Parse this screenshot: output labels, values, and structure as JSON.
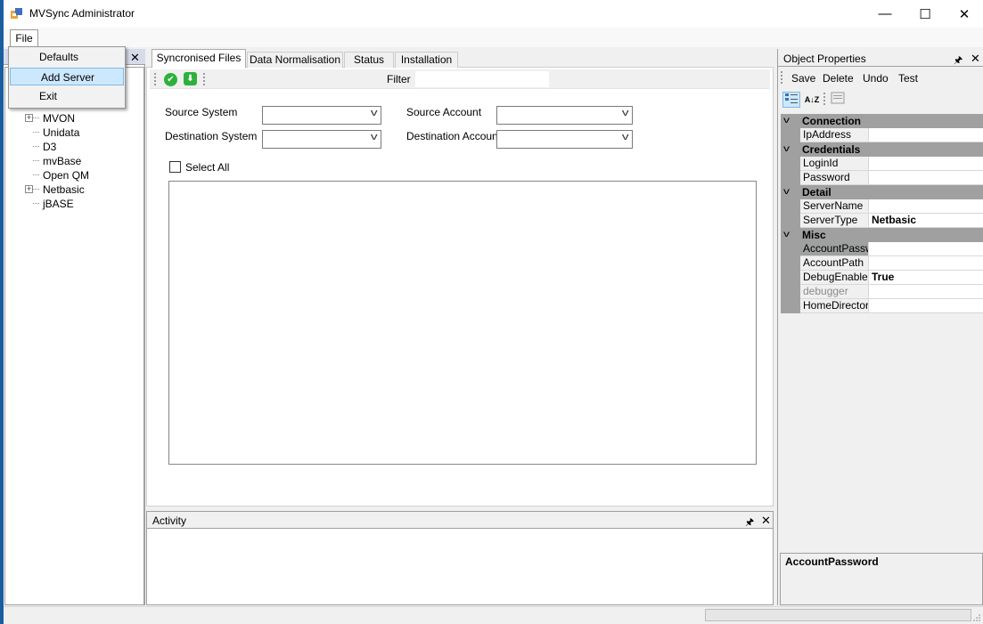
{
  "window": {
    "title": "MVSync Administrator",
    "minimize": "—",
    "maximize": "☐",
    "close": "✕"
  },
  "menu": {
    "file": "File",
    "items": [
      "Defaults",
      "Add Server",
      "Exit"
    ],
    "highlighted": "Add Server"
  },
  "left_panel": {
    "close": "✕",
    "tree": [
      {
        "label": "MVON",
        "expandable": true
      },
      {
        "label": "Unidata",
        "expandable": false
      },
      {
        "label": "D3",
        "expandable": false
      },
      {
        "label": "mvBase",
        "expandable": false
      },
      {
        "label": "Open QM",
        "expandable": false
      },
      {
        "label": "Netbasic",
        "expandable": true
      },
      {
        "label": "jBASE",
        "expandable": false
      }
    ],
    "expander": "+"
  },
  "tabs": [
    "Syncronised Files",
    "Data Normalisation",
    "Status",
    "Installation"
  ],
  "toolbar": {
    "filter_label": "Filter",
    "filter_value": "",
    "accept_icon": "✔",
    "download_icon": "⬇"
  },
  "form": {
    "source_system": "Source System",
    "destination_system": "Destination System",
    "source_account": "Source Account",
    "destination_account": "Destination Account",
    "select_all": "Select All",
    "chevron": "v"
  },
  "activity": {
    "title": "Activity",
    "pin": "🖈",
    "close": "✕"
  },
  "properties": {
    "title": "Object Properties",
    "pin": "🖈",
    "close": "✕",
    "actions": [
      "Save",
      "Delete",
      "Undo",
      "Test"
    ],
    "categories": [
      {
        "name": "Connection",
        "rows": [
          {
            "name": "IpAddress",
            "value": ""
          }
        ]
      },
      {
        "name": "Credentials",
        "rows": [
          {
            "name": "LoginId",
            "value": ""
          },
          {
            "name": "Password",
            "value": ""
          }
        ]
      },
      {
        "name": "Detail",
        "rows": [
          {
            "name": "ServerName",
            "value": ""
          },
          {
            "name": "ServerType",
            "value": "Netbasic"
          }
        ]
      },
      {
        "name": "Misc",
        "rows": [
          {
            "name": "AccountPassword",
            "value": ""
          },
          {
            "name": "AccountPath",
            "value": ""
          },
          {
            "name": "DebugEnabled",
            "value": "True"
          },
          {
            "name": "debugger",
            "value": ""
          },
          {
            "name": "HomeDirectory",
            "value": ""
          }
        ]
      }
    ],
    "description_title": "AccountPassword",
    "cat_chevron": "v",
    "sort_icon": "A↓Z"
  }
}
